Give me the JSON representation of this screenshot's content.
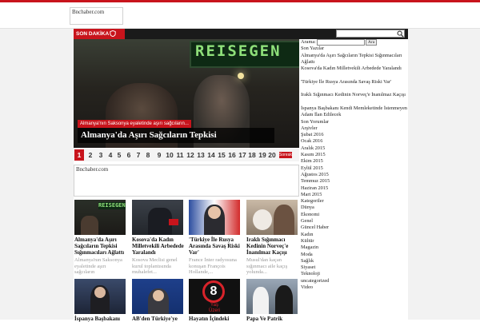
{
  "header": {
    "logo_text": "Bnchaber.com"
  },
  "newsbar": {
    "label": "SON DAKİKA",
    "icon": "shield-icon",
    "search_icon": "search-icon"
  },
  "slider": {
    "sign_text": "REISEGEN",
    "caption_small": "Almanya'nın Saksonya eyaletinde aşırı sağcıların...",
    "caption_title": "Almanya'da Aşırı Sağcıların Tepkisi",
    "pages": [
      "1",
      "2",
      "3",
      "4",
      "5",
      "6",
      "7",
      "8",
      "9",
      "10",
      "11",
      "12",
      "13",
      "14",
      "15",
      "16",
      "17",
      "18",
      "19",
      "20"
    ],
    "active_page": "1",
    "next_label": "Sonraki"
  },
  "ad": {
    "text": "Bnchaber.com"
  },
  "cards": [
    {
      "title": "Almanya'da Aşırı Sağcıların Tepkisi Sığınmacıları Ağlattı",
      "excerpt": "Almanya'nın Saksonya eyaletinde aşırı sağcıların"
    },
    {
      "title": "Kosova'da Kadın Milletvekili Arbedede Yaralandı",
      "excerpt": "Kosova Meclisi genel kurul toplantısında muhalefet..."
    },
    {
      "title": "'Türkiye İle Rusya Arasında Savaş Riski Var'",
      "excerpt": "France İnter radyosuna konuşan François Hollande,..."
    },
    {
      "title": "Iraklı Sığınmacı Kedinin Norveç'e İnanılmaz Kaçışı",
      "excerpt": "Musul'dan kaçan sığınmacı aile kaçış yolunda..."
    },
    {
      "title": "İspanya Başbakanı",
      "excerpt": ""
    },
    {
      "title": "AB'den Türkiye'ye",
      "excerpt": ""
    },
    {
      "title": "Hayatın İçindeki",
      "excerpt": ""
    },
    {
      "title": "Papa Ve Patrik",
      "excerpt": ""
    }
  ],
  "card8_badge": {
    "num": "8",
    "word": "Yaş",
    "word2": "Üzeri"
  },
  "sidebar": {
    "search_label": "Arama:",
    "search_button": "Ara",
    "items": [
      "Son Yazılar",
      "Almanya'da Aşırı Sağcıların Tepkisi Sığınmacıları Ağlattı",
      "Kosova'da Kadın Milletvekili Arbedede Yaralandı",
      "'Türkiye İle Rusya Arasında Savaş Riski Var'",
      "Iraklı Sığınmacı Kedinin Norveç'e İnanılmaz Kaçışı",
      "İspanya Başbakanı Kendi Memleketinde İstenmeyen Adam İlan Edilecek",
      "Son Yorumlar",
      "Arşivler",
      "Şubat 2016",
      "Ocak 2016",
      "Aralık 2015",
      "Kasım 2015",
      "Ekim 2015",
      "Eylül 2015",
      "Ağustos 2015",
      "Temmuz 2015",
      "Haziran 2015",
      "Mart 2015",
      "Kategoriler",
      "Dünya",
      "Ekonomi",
      "Genel",
      "Güncel Haber",
      "Kadın",
      "Kültür",
      "Magazin",
      "Moda",
      "Sağlık",
      "Siyaset",
      "Teknoloji",
      "uncategorized",
      "Video"
    ]
  },
  "colors": {
    "accent": "#c8141c",
    "bar": "#1a1a1a",
    "background": "#f2f2f2"
  }
}
